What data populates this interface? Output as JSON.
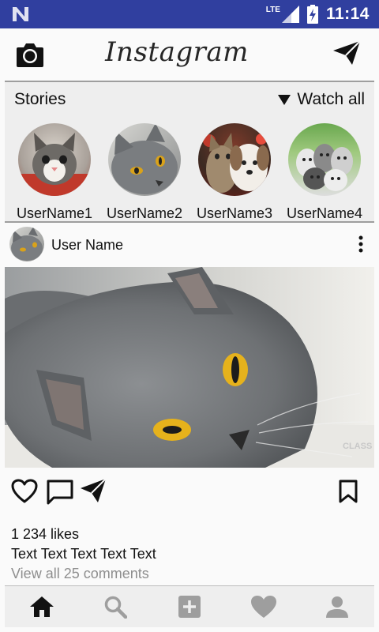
{
  "status_bar": {
    "network": "LTE",
    "time": "11:14"
  },
  "header": {
    "logo_text": "Instagram"
  },
  "stories": {
    "title": "Stories",
    "watch_all": "Watch all",
    "items": [
      {
        "username": "UserName1"
      },
      {
        "username": "UserName2"
      },
      {
        "username": "UserName3"
      },
      {
        "username": "UserName4"
      }
    ]
  },
  "post": {
    "author": "User Name",
    "likes": "1 234 likes",
    "caption": "Text Text Text Text Text",
    "comments_link": "View all 25 comments",
    "watermark": "CLASS"
  },
  "bottom_nav": {
    "items": [
      {
        "icon": "home-icon",
        "active": true
      },
      {
        "icon": "search-icon",
        "active": false
      },
      {
        "icon": "add-icon",
        "active": false
      },
      {
        "icon": "heart-icon",
        "active": false
      },
      {
        "icon": "profile-icon",
        "active": false
      }
    ]
  },
  "colors": {
    "status_bar": "#303f9f",
    "background": "#fafafa",
    "panel": "#eeeeee",
    "accent_eyes": "#e0a400"
  }
}
